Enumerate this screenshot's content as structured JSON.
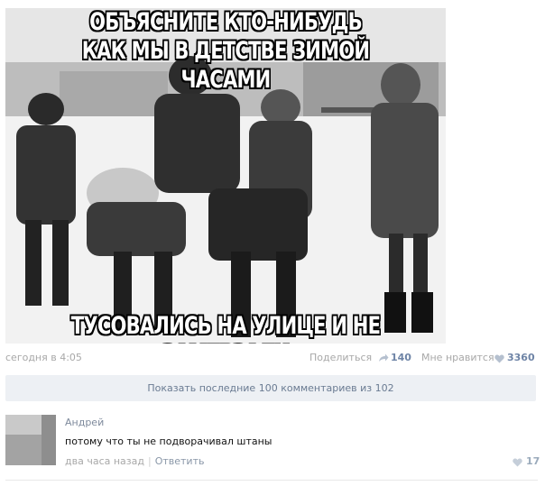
{
  "post": {
    "image": {
      "caption_top_line1": "ОБЪЯСНИТЕ КТО-НИБУДЬ",
      "caption_top_line2": "КАК МЫ В ДЕТСТВЕ ЗИМОЙ ЧАСАМИ",
      "caption_bottom": "ТУСОВАЛИСЬ НА УЛИЦЕ И НЕ ЗАМЕРЗАЛИ"
    },
    "date": "сегодня в 4:05",
    "share_label": "Поделиться",
    "share_count": "140",
    "like_label": "Мне нравится",
    "like_count": "3360",
    "share_icon": "share-arrow-icon",
    "like_icon": "heart-icon"
  },
  "show_more": {
    "label": "Показать последние 100 комментариев из 102"
  },
  "comment": {
    "author": "Андрей",
    "text": "потому что ты не подворачивал штаны",
    "time": "два часа назад",
    "separator": "|",
    "reply_label": "Ответить",
    "like_count": "17"
  },
  "colors": {
    "link": "#6e84a6",
    "muted": "#a8a8a8",
    "button_bg": "#edf0f4"
  }
}
